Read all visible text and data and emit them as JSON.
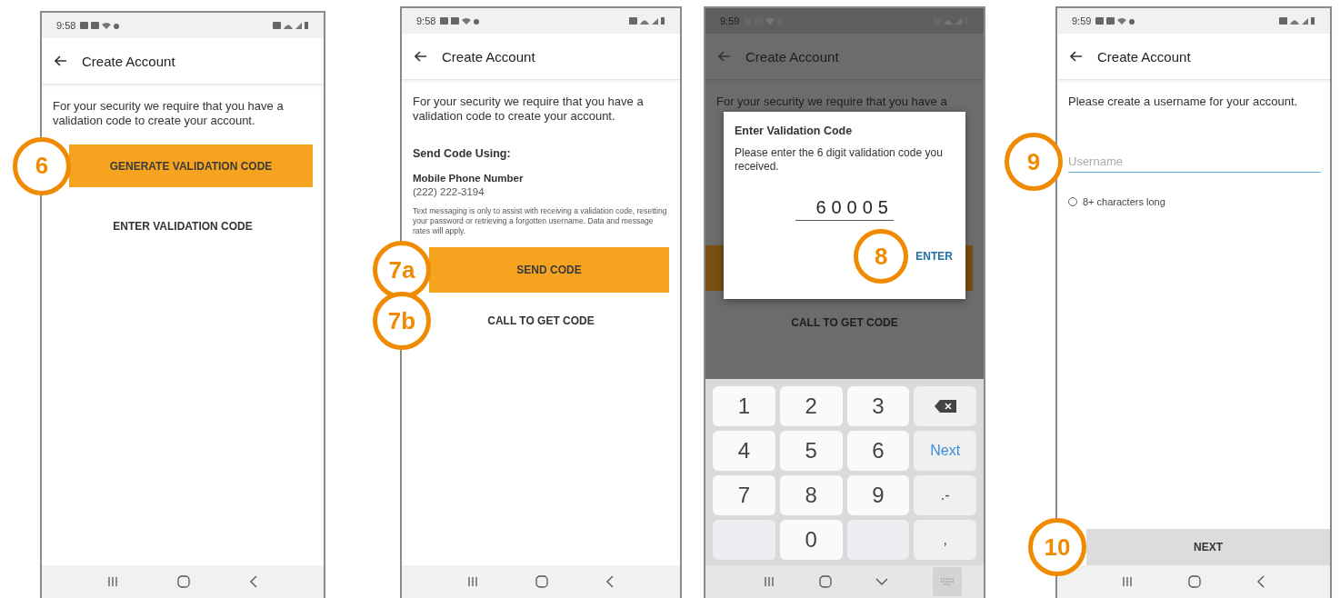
{
  "screens": [
    {
      "status_time": "9:58",
      "title": "Create Account",
      "dimmed": false,
      "blocks": [
        {
          "kind": "paragraph",
          "text": "For your security we require that you have a validation code to create your account."
        },
        {
          "kind": "primary-button",
          "text": "GENERATE VALIDATION CODE",
          "callout": "6"
        },
        {
          "kind": "text-button",
          "text": "ENTER VALIDATION CODE"
        }
      ]
    },
    {
      "status_time": "9:58",
      "title": "Create Account",
      "dimmed": false,
      "blocks": [
        {
          "kind": "paragraph",
          "text": "For your security we require that you have a validation code to create your account."
        },
        {
          "kind": "heading",
          "text": "Send Code Using:"
        },
        {
          "kind": "label",
          "text": "Mobile Phone Number"
        },
        {
          "kind": "value",
          "text": "(222) 222-3194"
        },
        {
          "kind": "fineprint",
          "text": "Text messaging is only to assist with receiving a validation code, resetting your password or retrieving a forgotten username. Data and message rates will apply."
        },
        {
          "kind": "primary-button",
          "text": "SEND CODE",
          "callout": "7a"
        },
        {
          "kind": "text-button",
          "text": "CALL TO GET CODE",
          "callout": "7b"
        }
      ]
    },
    {
      "status_time": "9:59",
      "title": "Create Account",
      "dimmed": true,
      "blocks": [
        {
          "kind": "paragraph",
          "text": "For your security we require that you have a"
        },
        {
          "kind": "covered-button"
        },
        {
          "kind": "text-button",
          "text": "CALL TO GET CODE"
        }
      ],
      "dialog": {
        "title": "Enter Validation Code",
        "message": "Please enter the 6 digit validation code you received.",
        "value": "60005",
        "action": "ENTER",
        "callout": "8"
      },
      "keypad": [
        {
          "kind": "digit",
          "label": "1"
        },
        {
          "kind": "digit",
          "label": "2"
        },
        {
          "kind": "digit",
          "label": "3"
        },
        {
          "kind": "backspace"
        },
        {
          "kind": "digit",
          "label": "4"
        },
        {
          "kind": "digit",
          "label": "5"
        },
        {
          "kind": "digit",
          "label": "6"
        },
        {
          "kind": "action",
          "label": "Next"
        },
        {
          "kind": "digit",
          "label": "7"
        },
        {
          "kind": "digit",
          "label": "8"
        },
        {
          "kind": "digit",
          "label": "9"
        },
        {
          "kind": "symbol",
          "label": ".-"
        },
        {
          "kind": "blank"
        },
        {
          "kind": "digit",
          "label": "0"
        },
        {
          "kind": "blank"
        },
        {
          "kind": "symbol",
          "label": ","
        }
      ]
    },
    {
      "status_time": "9:59",
      "title": "Create Account",
      "dimmed": false,
      "blocks": [
        {
          "kind": "paragraph",
          "text": "Please create a username for your account."
        },
        {
          "kind": "text-field",
          "placeholder": "Username",
          "callout": "9"
        },
        {
          "kind": "requirement",
          "text": "8+ characters long",
          "checked": false
        }
      ],
      "footer": {
        "label": "NEXT",
        "callout": "10"
      }
    }
  ]
}
